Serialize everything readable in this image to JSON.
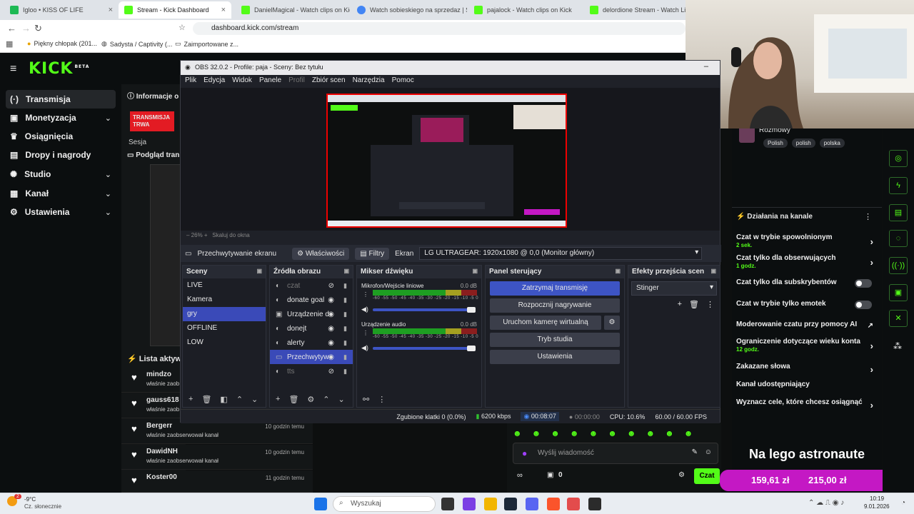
{
  "browser": {
    "tabs": [
      {
        "label": "Igloo • KISS OF LIFE",
        "color": "#1db954"
      },
      {
        "label": "Stream - Kick Dashboard",
        "color": "#53fc18"
      },
      {
        "label": "DanielMagical - Watch clips on Kick",
        "color": "#53fc18"
      },
      {
        "label": "Watch sobieskiego na sprzedaz | Str",
        "color": "#4285f4"
      },
      {
        "label": "pajalock - Watch clips on Kick",
        "color": "#53fc18"
      },
      {
        "label": "delordione Stream - Watch Live on",
        "color": "#53fc18"
      }
    ],
    "url": "dashboard.kick.com/stream",
    "bookmarks": [
      "Piękny chłopak (201...",
      "Sadysta / Captivity (...",
      "Zaimportowane z..."
    ]
  },
  "kick": {
    "logo": "KICK",
    "beta": "BETA",
    "nav": [
      {
        "label": "Transmisja",
        "icon": "broadcast-icon",
        "chev": ""
      },
      {
        "label": "Monetyzacja",
        "icon": "dollar-icon",
        "chev": "⌄"
      },
      {
        "label": "Osiągnięcia",
        "icon": "trophy-icon",
        "chev": ""
      },
      {
        "label": "Dropy i nagrody",
        "icon": "gift-icon",
        "chev": ""
      },
      {
        "label": "Studio",
        "icon": "studio-icon",
        "chev": "⌄"
      },
      {
        "label": "Kanał",
        "icon": "channel-icon",
        "chev": "⌄"
      },
      {
        "label": "Ustawienia",
        "icon": "gear-icon",
        "chev": "⌄"
      }
    ],
    "info_title": "Informacje o",
    "live_badge": "TRANSMISJA TRWA",
    "session_label": "Sesja",
    "preview_title": "Podgląd trans",
    "list_title": "Lista aktywn",
    "followers": [
      {
        "name": "mindzo",
        "sub": "właśnie zaob",
        "time": ""
      },
      {
        "name": "gauss618",
        "sub": "właśnie zaob",
        "time": ""
      },
      {
        "name": "Bergerr",
        "sub": "właśnie zaobserwował kanał",
        "time": "10 godzin temu"
      },
      {
        "name": "DawidNH",
        "sub": "właśnie zaobserwował kanał",
        "time": "10 godzin temu"
      },
      {
        "name": "Koster00",
        "sub": "",
        "time": "11 godzin temu"
      }
    ],
    "chat_placeholder": "Wyślij wiadomość",
    "chat_button": "Czat",
    "points": "0",
    "category": "Rozmowy",
    "tags": [
      "Polish",
      "polish",
      "polska"
    ],
    "actions_title": "Działania na kanale",
    "actions": [
      {
        "label": "Czat w trybie spowolnionym",
        "status": "2 sek.",
        "type": "arrow"
      },
      {
        "label": "Czat tylko dla obserwujących",
        "status": "1 godz.",
        "type": "arrow"
      },
      {
        "label": "Czat tylko dla subskrybentów",
        "status": "",
        "type": "toggle"
      },
      {
        "label": "Czat w trybie tylko emotek",
        "status": "",
        "type": "toggle"
      },
      {
        "label": "Moderowanie czatu przy pomocy AI",
        "status": "",
        "type": "external"
      },
      {
        "label": "Ograniczenie dotyczące wieku konta",
        "status": "12 godz.",
        "type": "arrow"
      },
      {
        "label": "Zakazane słowa",
        "status": "",
        "type": "arrow"
      },
      {
        "label": "Kanał udostępniający",
        "status": "",
        "type": "none"
      },
      {
        "label": "Wyznacz cele, które chcesz osiągnąć",
        "status": "",
        "type": "arrow"
      }
    ],
    "goal_text": "Na lego astronaute",
    "goal_current": "159,61 zł",
    "goal_target": "215,00 zł"
  },
  "obs": {
    "title": "OBS 32.0.2 - Profile: paja - Sceny: Bez tytułu",
    "menu": [
      "Plik",
      "Edycja",
      "Widok",
      "Panele",
      "Profil",
      "Zbiór scen",
      "Narzędzia",
      "Pomoc"
    ],
    "zoom": "26%",
    "zoom_label": "Skaluj do okna",
    "source_name": "Przechwytywanie ekranu",
    "props_btn": "Właściwości",
    "filters_btn": "Filtry",
    "screen_label": "Ekran",
    "screen_value": "LG ULTRAGEAR: 1920x1080 @ 0,0 (Monitor główny)",
    "panels": {
      "scenes": "Sceny",
      "sources": "Źródła obrazu",
      "mixer": "Mikser dźwięku",
      "controls": "Panel sterujący",
      "transitions": "Efekty przejścia scen"
    },
    "scenes": [
      "LIVE",
      "Kamera",
      "gry",
      "OFFLINE",
      "LOW"
    ],
    "sources": [
      "czat",
      "donate goal",
      "Urządzenie d",
      "donejt",
      "alerty",
      "Przechwytyw",
      "tts"
    ],
    "mixer": [
      {
        "name": "Mikrofon/Wejście liniowe",
        "db": "0.0 dB"
      },
      {
        "name": "Urządzenie audio",
        "db": "0.0 dB"
      }
    ],
    "meter_scale": "-60 -55 -50 -45 -40 -35 -30 -25 -20 -15 -10 -5 0",
    "controls": [
      "Zatrzymaj transmisję",
      "Rozpocznij nagrywanie",
      "Uruchom kamerę wirtualną",
      "Tryb studia",
      "Ustawienia"
    ],
    "transition": "Stinger",
    "status": {
      "dropped": "Zgubione klatki 0 (0.0%)",
      "bitrate": "6200 kbps",
      "live_time": "00:08:07",
      "rec_time": "00:00:00",
      "cpu": "CPU: 10.6%",
      "fps": "60.00 / 60.00 FPS"
    }
  },
  "taskbar": {
    "weather_temp": "-9°C",
    "weather_desc": "Cz. słonecznie",
    "weather_badge": "2",
    "search": "Wyszukaj",
    "time": "10:19",
    "date": "9.01.2026"
  },
  "colors": {
    "kick_green": "#53fc18",
    "obs_blue": "#3d54c4",
    "live_red": "#e31b23",
    "goal_magenta": "#c418c4"
  }
}
